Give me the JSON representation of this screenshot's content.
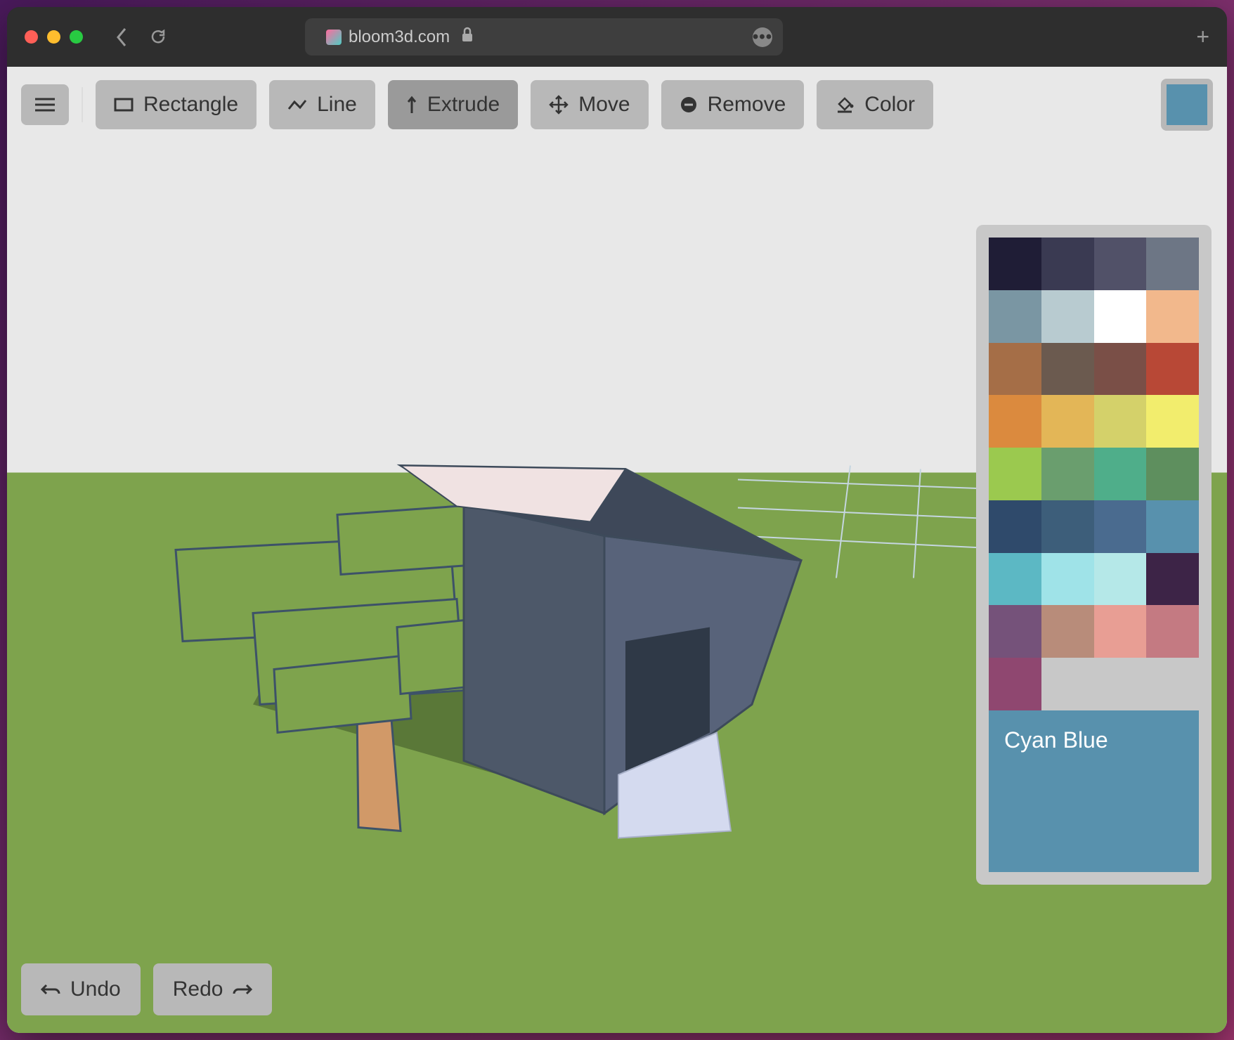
{
  "browser": {
    "url": "bloom3d.com"
  },
  "toolbar": {
    "rectangle": "Rectangle",
    "line": "Line",
    "extrude": "Extrude",
    "move": "Move",
    "remove": "Remove",
    "color": "Color"
  },
  "bottom": {
    "undo": "Undo",
    "redo": "Redo"
  },
  "color_panel": {
    "selected_name": "Cyan Blue",
    "selected_hex": "#5891ad",
    "swatches": [
      "#1f1d36",
      "#3a3a52",
      "#515168",
      "#6d7685",
      "#7a96a3",
      "#b8cbd0",
      "#ffffff",
      "#f2b88c",
      "#a56e47",
      "#6b5a4f",
      "#7a4f47",
      "#b84836",
      "#db8a3e",
      "#e3b657",
      "#d4d16a",
      "#f2ed6d",
      "#9bc94f",
      "#6a9e6e",
      "#4fae8a",
      "#5e8f5e",
      "#2f4a6b",
      "#3d5e7a",
      "#4a6b8f",
      "#5891ad",
      "#5cb8c4",
      "#9fe3e8",
      "#b5e8e8",
      "#3d2447",
      "#75527a",
      "#b88c7a",
      "#e89e94",
      "#c47a82",
      "#8f4770",
      "#c8c8c8",
      "#c8c8c8",
      "#c8c8c8"
    ]
  }
}
